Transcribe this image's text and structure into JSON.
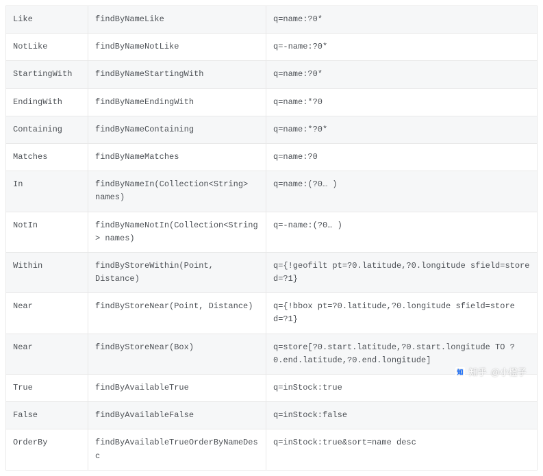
{
  "rows": [
    {
      "keyword": "Like",
      "method": "findByNameLike",
      "query": "q=name:?0*"
    },
    {
      "keyword": "NotLike",
      "method": "findByNameNotLike",
      "query": "q=-name:?0*"
    },
    {
      "keyword": "StartingWith",
      "method": "findByNameStartingWith",
      "query": "q=name:?0*"
    },
    {
      "keyword": "EndingWith",
      "method": "findByNameEndingWith",
      "query": "q=name:*?0"
    },
    {
      "keyword": "Containing",
      "method": "findByNameContaining",
      "query": "q=name:*?0*"
    },
    {
      "keyword": "Matches",
      "method": "findByNameMatches",
      "query": "q=name:?0"
    },
    {
      "keyword": "In",
      "method": "findByNameIn(Collection<String> names)",
      "query": "q=name:(?0… )"
    },
    {
      "keyword": "NotIn",
      "method": "findByNameNotIn(Collection<String> names)",
      "query": "q=-name:(?0… )"
    },
    {
      "keyword": "Within",
      "method": "findByStoreWithin(Point, Distance)",
      "query": "q={!geofilt pt=?0.latitude,?0.longitude sfield=store d=?1}"
    },
    {
      "keyword": "Near",
      "method": "findByStoreNear(Point, Distance)",
      "query": "q={!bbox pt=?0.latitude,?0.longitude sfield=store d=?1}"
    },
    {
      "keyword": "Near",
      "method": "findByStoreNear(Box)",
      "query": "q=store[?0.start.latitude,?0.start.longitude TO ?0.end.latitude,?0.end.longitude]"
    },
    {
      "keyword": "True",
      "method": "findByAvailableTrue",
      "query": "q=inStock:true"
    },
    {
      "keyword": "False",
      "method": "findByAvailableFalse",
      "query": "q=inStock:false"
    },
    {
      "keyword": "OrderBy",
      "method": "findByAvailableTrueOrderByNameDesc",
      "query": "q=inStock:true&sort=name desc"
    }
  ],
  "watermark": {
    "site": "知乎",
    "author": "@小橙子"
  }
}
